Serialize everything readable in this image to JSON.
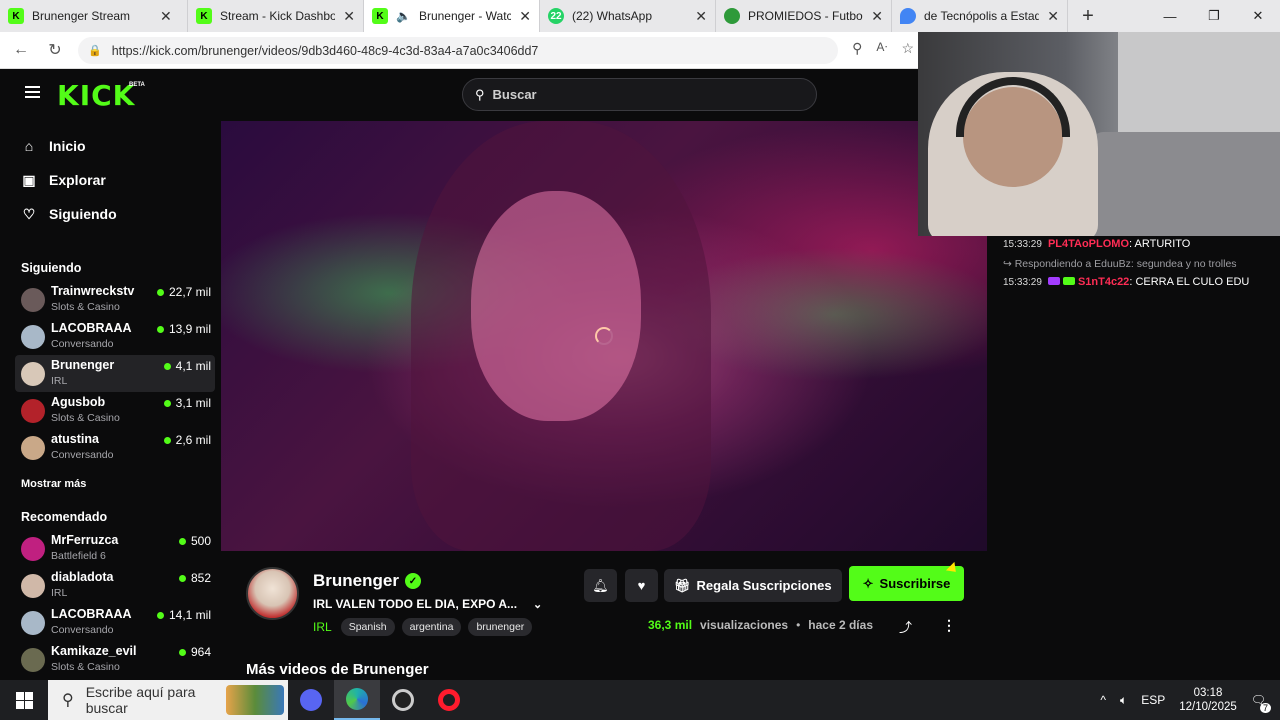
{
  "browser": {
    "tabs": [
      {
        "title": "Brunenger Stream",
        "favicon": "kick-icon",
        "active": false
      },
      {
        "title": "Stream - Kick Dashboard",
        "favicon": "kick-icon",
        "active": false
      },
      {
        "title": "Brunenger - Watch",
        "favicon": "kick-icon",
        "active": true
      },
      {
        "title": "(22) WhatsApp",
        "favicon": "whatsapp-icon",
        "active": false
      },
      {
        "title": "PROMIEDOS - Futbol Ar",
        "favicon": "promiedos-icon",
        "active": false
      },
      {
        "title": "de Tecnópolis a Estadio",
        "favicon": "maps-icon",
        "active": false
      }
    ],
    "url": "https://kick.com/brunenger/videos/9db3d460-48c9-4c3d-83a4-a7a0c3406dd7"
  },
  "kick": {
    "logo": "KICK",
    "beta": "BETA",
    "search_placeholder": "Buscar",
    "nav": {
      "home": "Inicio",
      "explore": "Explorar",
      "following": "Siguiendo"
    },
    "following_title": "Siguiendo",
    "following": [
      {
        "name": "Trainwreckstv",
        "category": "Slots & Casino",
        "viewers": "22,7 mil"
      },
      {
        "name": "LACOBRAAA",
        "category": "Conversando",
        "viewers": "13,9 mil"
      },
      {
        "name": "Brunenger",
        "category": "IRL",
        "viewers": "4,1 mil"
      },
      {
        "name": "Agusbob",
        "category": "Slots & Casino",
        "viewers": "3,1 mil"
      },
      {
        "name": "atustina",
        "category": "Conversando",
        "viewers": "2,6 mil"
      }
    ],
    "show_more": "Mostrar más",
    "recommended_title": "Recomendado",
    "recommended": [
      {
        "name": "MrFerruzca",
        "category": "Battlefield 6",
        "viewers": "500"
      },
      {
        "name": "diabladota",
        "category": "IRL",
        "viewers": "852"
      },
      {
        "name": "LACOBRAAA",
        "category": "Conversando",
        "viewers": "14,1 mil"
      },
      {
        "name": "Kamikaze_evil",
        "category": "Slots & Casino",
        "viewers": "964"
      }
    ],
    "video": {
      "channel": "Brunenger",
      "title": "IRL VALEN TODO EL DIA, EXPO A...",
      "category": "IRL",
      "tags": [
        "Spanish",
        "argentina",
        "brunenger"
      ],
      "views_num": "36,3 mil",
      "views_label": "visualizaciones",
      "separator": "•",
      "age": "hace 2 días",
      "gift_label": "Regala Suscripciones",
      "subscribe_label": "Suscribirse",
      "more_videos": "Más videos de Brunenger"
    },
    "chat": [
      {
        "time": "15:33:29",
        "user": "PL4TAoPLOMO",
        "text": "ARTURITO"
      },
      {
        "reply": "Respondiendo a EduuBz: segundea y no trolles"
      },
      {
        "time": "15:33:29",
        "user": "S1nT4c22",
        "text": "CERRA EL CULO EDU"
      }
    ]
  },
  "taskbar": {
    "search_placeholder": "Escribe aquí para buscar",
    "lang": "ESP",
    "time": "03:18",
    "date": "12/10/2025",
    "notifications": "7"
  },
  "colors": {
    "accent": "#53fc18",
    "chat_user": "#ff2d55",
    "background": "#0b0b0c"
  }
}
